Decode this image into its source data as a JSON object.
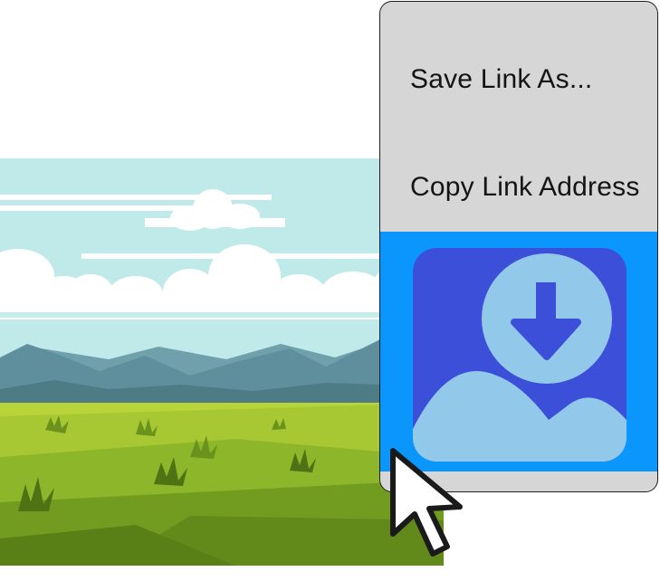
{
  "context_menu": {
    "items": [
      {
        "label": "Save Link As..."
      },
      {
        "label": "Copy Link Address"
      }
    ],
    "highlighted_item_icon": "save-image-download-icon",
    "highlight_color": "#0a96fc"
  },
  "scene": {
    "image_icon": "landscape-illustration"
  },
  "cursor": {
    "icon": "mouse-pointer-arrow"
  }
}
